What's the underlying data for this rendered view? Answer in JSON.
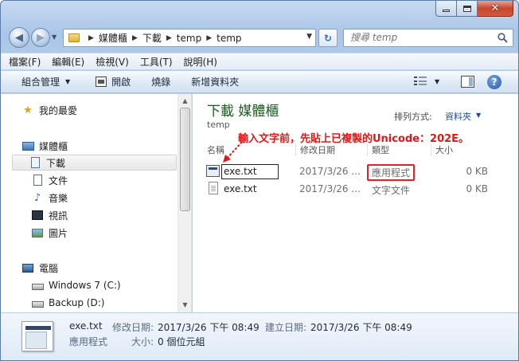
{
  "window": {
    "caption": {
      "minimize": "",
      "maximize": "",
      "close": "✕"
    }
  },
  "address": {
    "crumbs": [
      "媒體櫃",
      "下載",
      "temp",
      "temp"
    ]
  },
  "search": {
    "placeholder": "搜尋 temp"
  },
  "menu": [
    "檔案(F)",
    "編輯(E)",
    "檢視(V)",
    "工具(T)",
    "說明(H)"
  ],
  "toolbar": {
    "organize": "組合管理",
    "open": "開啟",
    "burn": "燒錄",
    "new_folder": "新增資料夾",
    "help": "?"
  },
  "nav": {
    "items": [
      {
        "label": "我的最愛",
        "icon": "star-icon"
      },
      {
        "label": "媒體櫃",
        "icon": "library-icon"
      },
      {
        "label": "下載",
        "icon": "downloads-icon"
      },
      {
        "label": "文件",
        "icon": "documents-icon"
      },
      {
        "label": "音樂",
        "icon": "music-icon"
      },
      {
        "label": "視訊",
        "icon": "video-icon"
      },
      {
        "label": "圖片",
        "icon": "pictures-icon"
      },
      {
        "label": "電腦",
        "icon": "computer-icon"
      },
      {
        "label": "Windows 7 (C:)",
        "icon": "drive-c-icon"
      },
      {
        "label": "Backup (D:)",
        "icon": "drive-d-icon"
      }
    ]
  },
  "content": {
    "title": "下載 媒體櫃",
    "subtitle": "temp",
    "arrange_label": "排列方式:",
    "arrange_value": "資料夾",
    "annotation": "輸入文字前，先貼上已複製的Unicode：202E。",
    "columns": {
      "name": "名稱",
      "modified": "修改日期",
      "type": "類型",
      "size": "大小"
    },
    "files": [
      {
        "name": "exe.txt",
        "modified": "2017/3/26 ...",
        "type": "應用程式",
        "size": "0 KB"
      },
      {
        "name": "exe.txt",
        "modified": "2017/3/26 ...",
        "type": "文字文件",
        "size": "0 KB"
      }
    ]
  },
  "details": {
    "filename": "exe.txt",
    "modified_label": "修改日期:",
    "modified_value": "2017/3/26 下午 08:49",
    "created_label": "建立日期:",
    "created_value": "2017/3/26 下午 08:49",
    "type": "應用程式",
    "size_label": "大小:",
    "size_value": "0 個位元組"
  },
  "colors": {
    "annotation": "#e21616",
    "library_title": "#1e5a24",
    "highlight_box": "#e42020"
  }
}
